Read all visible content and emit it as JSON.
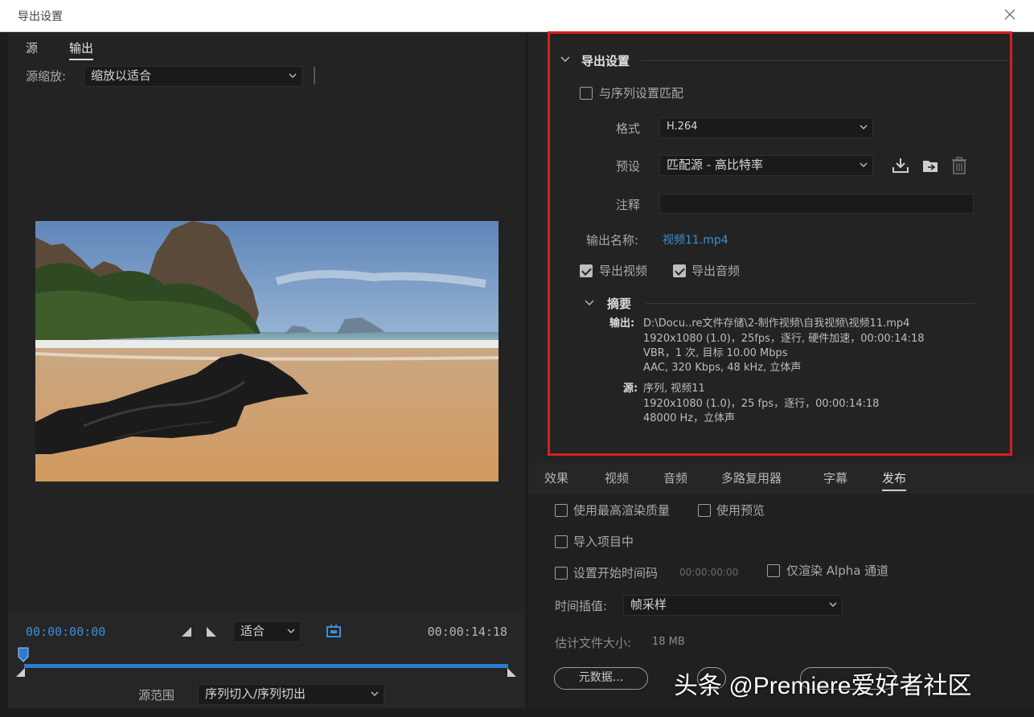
{
  "window": {
    "title": "导出设置"
  },
  "left": {
    "tabs": [
      {
        "label": "源"
      },
      {
        "label": "输出"
      }
    ],
    "source_scale": {
      "label": "源缩放:",
      "value": "缩放以适合"
    },
    "timecode_start": "00:00:00:00",
    "timecode_end": "00:00:14:18",
    "fit": {
      "value": "适合"
    },
    "source_range": {
      "label": "源范围",
      "value": "序列切入/序列切出"
    }
  },
  "export_settings": {
    "header": "导出设置",
    "match_sequence": {
      "label": "与序列设置匹配",
      "checked": false
    },
    "format": {
      "label": "格式",
      "value": "H.264"
    },
    "preset": {
      "label": "预设",
      "value": "匹配源 - 高比特率"
    },
    "comment": {
      "label": "注释",
      "value": ""
    },
    "output_name": {
      "label": "输出名称:",
      "value": "视频11.mp4"
    },
    "export_video": {
      "label": "导出视频",
      "checked": true
    },
    "export_audio": {
      "label": "导出音频",
      "checked": true
    },
    "summary": {
      "header": "摘要",
      "output_label": "输出:",
      "output_lines": [
        "D:\\Docu..re文件存储\\2-制作视频\\自我视频\\视频11.mp4",
        "1920x1080 (1.0)，25fps，逐行, 硬件加速，00:00:14:18",
        "VBR，1 次, 目标 10.00 Mbps",
        "AAC, 320 Kbps, 48  kHz, 立体声"
      ],
      "source_label": "源:",
      "source_lines": [
        "序列, 视频11",
        "1920x1080 (1.0)，25 fps，逐行，00:00:14:18",
        "48000 Hz，立体声"
      ]
    }
  },
  "bottom_tabs": [
    {
      "label": "效果"
    },
    {
      "label": "视频"
    },
    {
      "label": "音频"
    },
    {
      "label": "多路复用器"
    },
    {
      "label": "字幕"
    },
    {
      "label": "发布"
    }
  ],
  "options": {
    "max_render_quality": {
      "label": "使用最高渲染质量",
      "checked": false
    },
    "use_previews": {
      "label": "使用预览",
      "checked": false
    },
    "import_into_project": {
      "label": "导入项目中",
      "checked": false
    },
    "set_start_timecode": {
      "label": "设置开始时间码",
      "value": "00:00:00:00",
      "checked": false
    },
    "render_alpha_only": {
      "label": "仅渲染 Alpha 通道",
      "checked": false
    },
    "time_interpolation": {
      "label": "时间插值:",
      "value": "帧采样"
    },
    "estimated_size": {
      "label": "估计文件大小:",
      "value": "18 MB"
    },
    "metadata_button": "元数据..."
  },
  "watermark": "头条 @Premiere爱好者社区",
  "colors": {
    "accent_blue": "#3a8fd9",
    "highlight_red": "#d62020"
  }
}
